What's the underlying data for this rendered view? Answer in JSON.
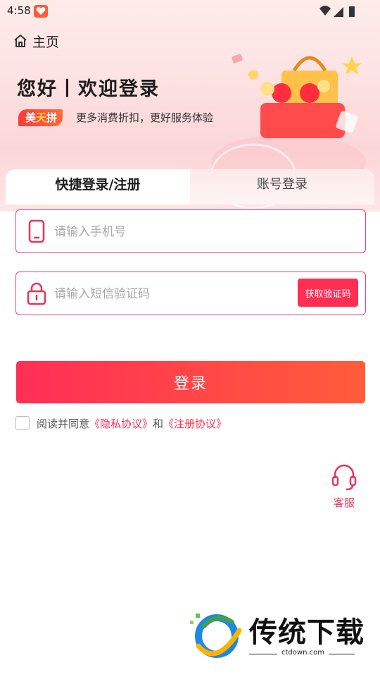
{
  "status_bar": {
    "time": "4:58"
  },
  "header": {
    "home_label": "主页"
  },
  "hero": {
    "title": "您好丨欢迎登录",
    "brand_badge": [
      "美",
      "天",
      "拼"
    ],
    "subtitle": "更多消费折扣，更好服务体验"
  },
  "tabs": [
    {
      "label": "快捷登录/注册",
      "active": true
    },
    {
      "label": "账号登录",
      "active": false
    }
  ],
  "form": {
    "phone_placeholder": "请输入手机号",
    "phone_value": "",
    "code_placeholder": "请输入短信验证码",
    "code_value": "",
    "get_code_label": "获取验证码",
    "login_label": "登录"
  },
  "agreement": {
    "checked": false,
    "prefix": "阅读并同意",
    "privacy_link": "《隐私协议》",
    "and": "和",
    "register_link": "《注册协议》"
  },
  "service": {
    "label": "客服"
  },
  "watermark": {
    "name": "传统下载",
    "url": "ctdown.com"
  },
  "colors": {
    "accent": "#ff2e55",
    "border": "#e0487a",
    "service": "#e8345a"
  }
}
